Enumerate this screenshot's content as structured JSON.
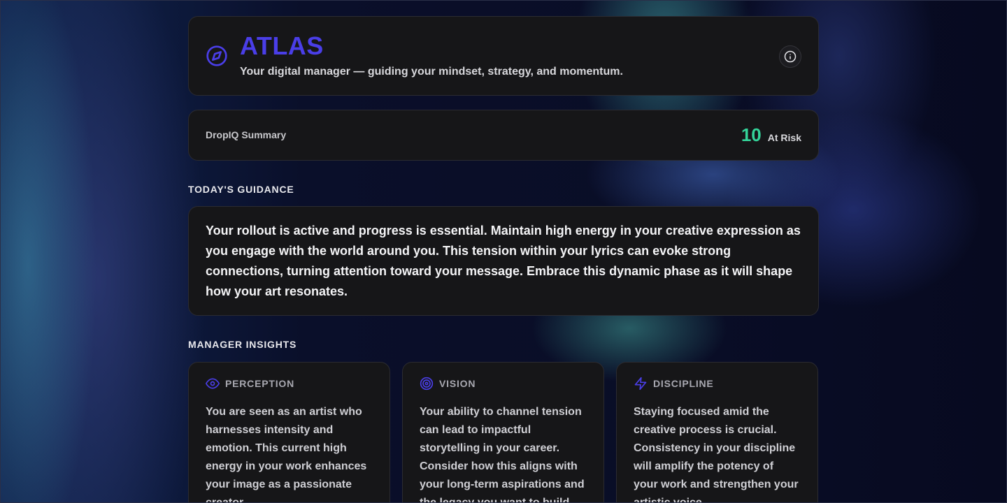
{
  "header": {
    "title": "ATLAS",
    "subtitle": "Your digital manager — guiding your mindset, strategy, and momentum.",
    "icon": "compass-icon",
    "info_icon": "info-icon",
    "accent_color": "#4a3ee8"
  },
  "summary": {
    "label": "DropIQ Summary",
    "value": "10",
    "status": "At Risk",
    "value_color": "#34d399"
  },
  "guidance": {
    "section_label": "TODAY'S GUIDANCE",
    "text": "Your rollout is active and progress is essential. Maintain high energy in your creative expression as you engage with the world around you. This tension within your lyrics can evoke strong connections, turning attention toward your message. Embrace this dynamic phase as it will shape how your art resonates."
  },
  "insights": {
    "section_label": "MANAGER INSIGHTS",
    "items": [
      {
        "title": "PERCEPTION",
        "icon": "eye-icon",
        "text": "You are seen as an artist who harnesses intensity and emotion. This current high energy in your work enhances your image as a passionate creator."
      },
      {
        "title": "VISION",
        "icon": "target-icon",
        "text": "Your ability to channel tension can lead to impactful storytelling in your career. Consider how this aligns with your long-term aspirations and the legacy you want to build."
      },
      {
        "title": "DISCIPLINE",
        "icon": "lightning-icon",
        "text": "Staying focused amid the creative process is crucial. Consistency in your discipline will amplify the potency of your work and strengthen your artistic voice."
      }
    ]
  }
}
